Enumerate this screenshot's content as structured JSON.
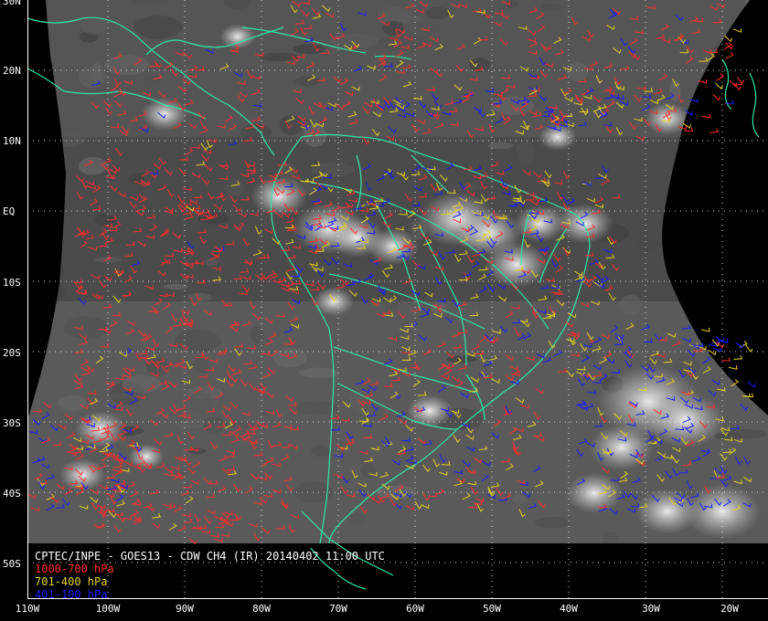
{
  "map": {
    "caption_title": "CPTEC/INPE - GOES13 - CDW CH4 (IR) 20140402 11:00 UTC",
    "legend": [
      {
        "label": "1000-700 hPa",
        "color": "#ff2a2a"
      },
      {
        "label": "701-400 hPa",
        "color": "#e6d21e"
      },
      {
        "label": "401-100 hPa",
        "color": "#1a1aff"
      }
    ],
    "lat_labels": [
      "30N",
      "20N",
      "10N",
      "EQ",
      "10S",
      "20S",
      "30S",
      "40S",
      "50S"
    ],
    "lon_labels": [
      "110W",
      "100W",
      "90W",
      "80W",
      "70W",
      "60W",
      "50W",
      "40W",
      "30W",
      "20W"
    ],
    "colors": {
      "coastline": "#2ee6a8",
      "grid": "#ffffff",
      "background": "#000000",
      "satellite_gray": "#4a4a4a"
    }
  }
}
